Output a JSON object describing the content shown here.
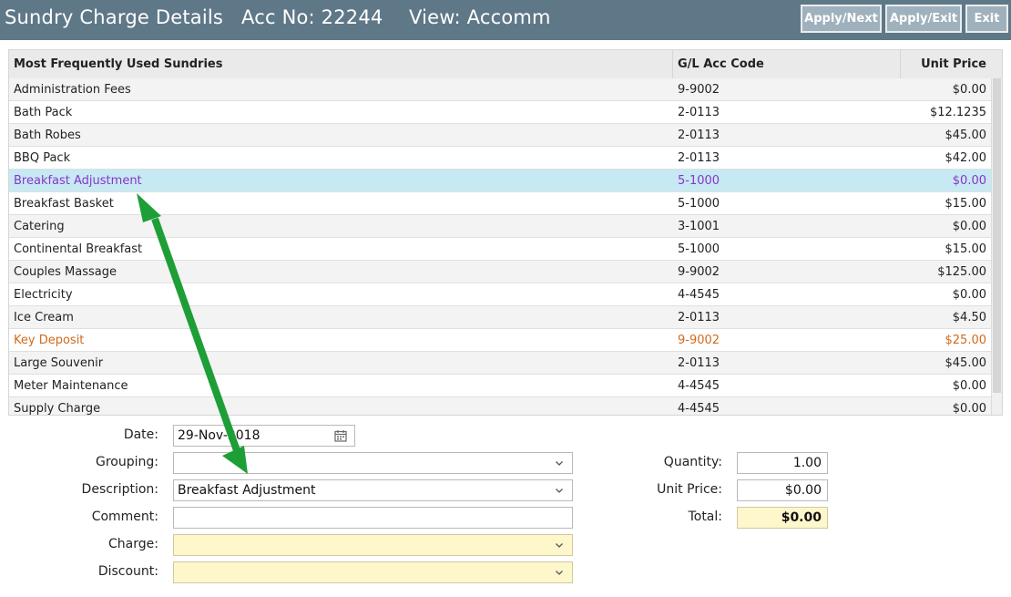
{
  "header": {
    "title": "Sundry Charge Details",
    "acc_no": "Acc No: 22244",
    "view": "View: Accomm",
    "buttons": {
      "apply_next": "Apply/Next",
      "apply_exit": "Apply/Exit",
      "exit": "Exit"
    }
  },
  "grid": {
    "columns": [
      "Most Frequently Used Sundries",
      "G/L Acc Code",
      "Unit Price"
    ],
    "rows": [
      {
        "name": "Administration Fees",
        "code": "9-9002",
        "price": "$0.00"
      },
      {
        "name": "Bath Pack",
        "code": "2-0113",
        "price": "$12.1235"
      },
      {
        "name": "Bath Robes",
        "code": "2-0113",
        "price": "$45.00"
      },
      {
        "name": "BBQ Pack",
        "code": "2-0113",
        "price": "$42.00"
      },
      {
        "name": "Breakfast Adjustment",
        "code": "5-1000",
        "price": "$0.00"
      },
      {
        "name": "Breakfast Basket",
        "code": "5-1000",
        "price": "$15.00"
      },
      {
        "name": "Catering",
        "code": "3-1001",
        "price": "$0.00"
      },
      {
        "name": "Continental Breakfast",
        "code": "5-1000",
        "price": "$15.00"
      },
      {
        "name": "Couples Massage",
        "code": "9-9002",
        "price": "$125.00"
      },
      {
        "name": "Electricity",
        "code": "4-4545",
        "price": "$0.00"
      },
      {
        "name": "Ice Cream",
        "code": "2-0113",
        "price": "$4.50"
      },
      {
        "name": "Key Deposit",
        "code": "9-9002",
        "price": "$25.00"
      },
      {
        "name": "Large Souvenir",
        "code": "2-0113",
        "price": "$45.00"
      },
      {
        "name": "Meter Maintenance",
        "code": "4-4545",
        "price": "$0.00"
      },
      {
        "name": "Supply Charge",
        "code": "4-4545",
        "price": "$0.00"
      }
    ],
    "selected_index": 4,
    "highlight_index": 11
  },
  "form": {
    "date_label": "Date:",
    "date_value": "29-Nov-2018",
    "grouping_label": "Grouping:",
    "grouping_value": "",
    "description_label": "Description:",
    "description_value": "Breakfast Adjustment",
    "comment_label": "Comment:",
    "comment_value": "",
    "charge_label": "Charge:",
    "charge_value": "",
    "discount_label": "Discount:",
    "discount_value": "",
    "quantity_label": "Quantity:",
    "quantity_value": "1.00",
    "unit_price_label": "Unit Price:",
    "unit_price_value": "$0.00",
    "total_label": "Total:",
    "total_value": "$0.00"
  },
  "colors": {
    "header_bg": "#5f7888",
    "selected_row_bg": "#c6e9f3",
    "selected_row_text": "#8a35c8",
    "highlight_row_text": "#d2691e",
    "required_field_bg": "#fff7cc",
    "arrow": "#1e9e36"
  },
  "icons": [
    "calendar-icon",
    "chevron-down-icon"
  ]
}
